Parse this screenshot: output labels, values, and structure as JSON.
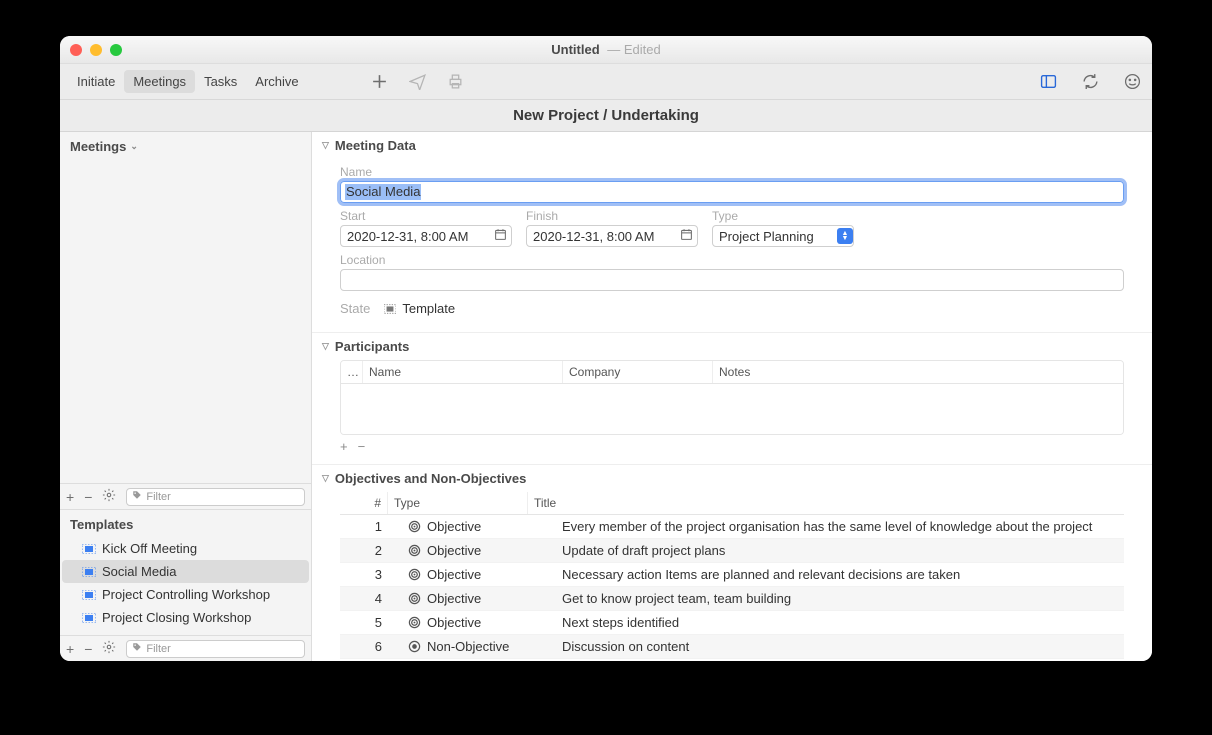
{
  "title": {
    "main": "Untitled",
    "edited": "— Edited"
  },
  "tabs": [
    "Initiate",
    "Meetings",
    "Tasks",
    "Archive"
  ],
  "active_tab": "Meetings",
  "subtitle": "New Project / Undertaking",
  "sidebar": {
    "meetings_header": "Meetings",
    "templates_header": "Templates",
    "templates": [
      "Kick Off Meeting",
      "Social Media",
      "Project Controlling Workshop",
      "Project Closing Workshop"
    ],
    "selected_template_index": 1,
    "filter_placeholder": "Filter"
  },
  "meeting_data": {
    "section_title": "Meeting Data",
    "name_label": "Name",
    "name_value": "Social Media",
    "start_label": "Start",
    "start_value": "2020-12-31, 8:00 AM",
    "finish_label": "Finish",
    "finish_value": "2020-12-31, 8:00 AM",
    "type_label": "Type",
    "type_value": "Project Planning",
    "location_label": "Location",
    "location_value": "",
    "state_label": "State",
    "state_value": "Template"
  },
  "participants": {
    "section_title": "Participants",
    "columns": {
      "idx": "…",
      "name": "Name",
      "company": "Company",
      "notes": "Notes"
    }
  },
  "objectives": {
    "section_title": "Objectives and Non-Objectives",
    "columns": {
      "num": "#",
      "type": "Type",
      "title": "Title"
    },
    "rows": [
      {
        "num": "1",
        "type": "Objective",
        "title": "Every member of the project organisation has the same level of knowledge about the project",
        "non": false
      },
      {
        "num": "2",
        "type": "Objective",
        "title": "Update of draft project plans",
        "non": false
      },
      {
        "num": "3",
        "type": "Objective",
        "title": "Necessary action Items are planned and relevant decisions are taken",
        "non": false
      },
      {
        "num": "4",
        "type": "Objective",
        "title": "Get to know project team, team building",
        "non": false
      },
      {
        "num": "5",
        "type": "Objective",
        "title": "Next steps identified",
        "non": false
      },
      {
        "num": "6",
        "type": "Non-Objective",
        "title": "Discussion on content",
        "non": true
      }
    ]
  }
}
